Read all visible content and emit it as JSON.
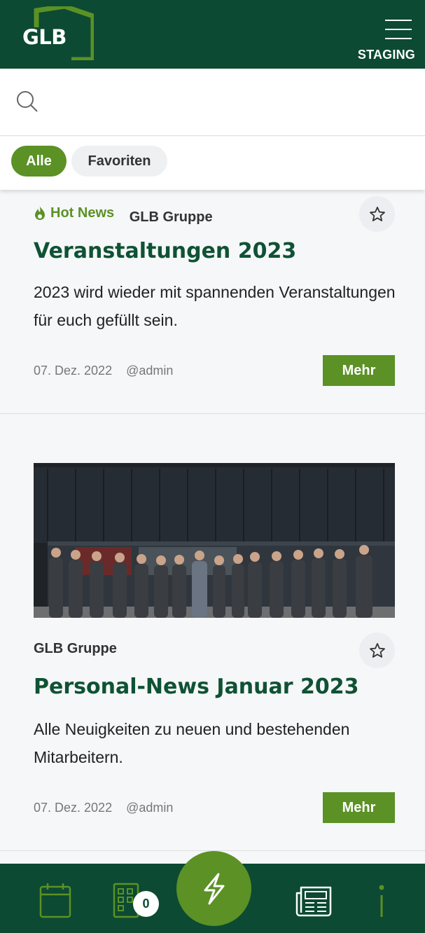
{
  "header": {
    "logo_text": "GLB",
    "environment_label": "STAGING"
  },
  "search": {
    "placeholder": "",
    "value": ""
  },
  "filters": {
    "all_label": "Alle",
    "favorites_label": "Favoriten",
    "active": "Alle"
  },
  "articles": [
    {
      "tag": "Hot News",
      "group": "GLB Gruppe",
      "title": "Veranstaltungen 2023",
      "description": "2023 wird wieder mit spannenden Veranstaltungen für euch gefüllt sein.",
      "date": "07. Dez. 2022",
      "author": "@admin",
      "more_label": "Mehr",
      "favorited": false
    },
    {
      "group": "GLB Gruppe",
      "title": "Personal-News Januar 2023",
      "description": "Alle Neuigkeiten zu neuen und bestehenden Mitarbeitern.",
      "date": "07. Dez. 2022",
      "author": "@admin",
      "more_label": "Mehr",
      "favorited": false,
      "image": "team-photo"
    }
  ],
  "bottom_nav": {
    "items": [
      "calendar-icon",
      "building-icon",
      "lightning-icon",
      "newspaper-icon",
      "info-icon"
    ],
    "building_badge": "0"
  },
  "colors": {
    "brand_dark": "#0c4a33",
    "accent_green": "#5b9125",
    "title_green": "#0f5234"
  }
}
